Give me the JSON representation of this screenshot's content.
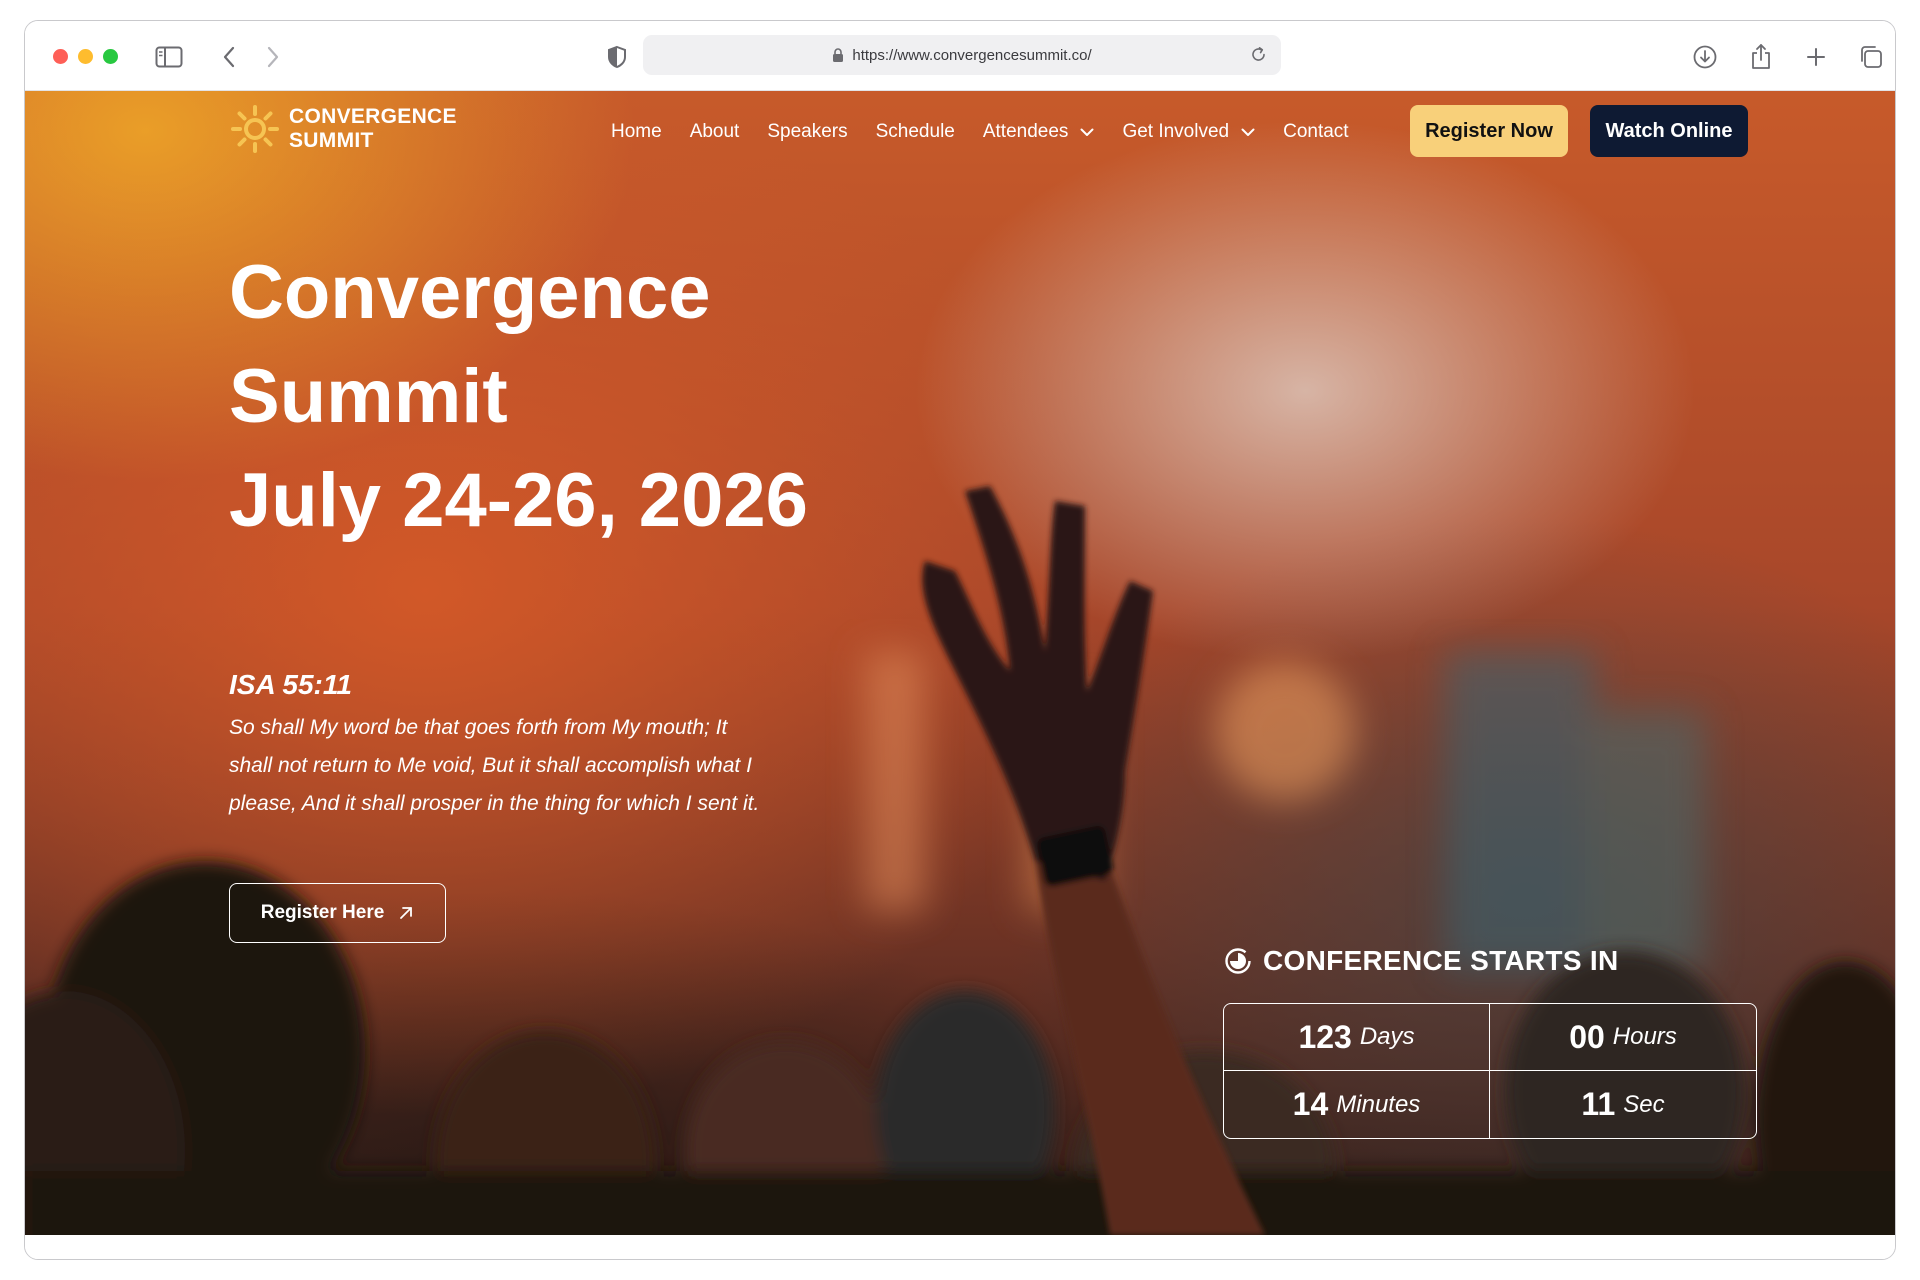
{
  "browser": {
    "url": "https://www.convergencesummit.co/"
  },
  "icons": {
    "sidebar": "sidebar-icon",
    "back": "chevron-left-icon",
    "forward": "chevron-right-icon",
    "shield": "shield-icon",
    "lock": "lock-icon",
    "reload": "reload-icon",
    "download": "download-icon",
    "share": "share-icon",
    "new_tab": "plus-icon",
    "tabs": "tabs-overview-icon"
  },
  "site": {
    "logo_line1": "CONVERGENCE",
    "logo_line2": "SUMMIT"
  },
  "nav": {
    "items": [
      "Home",
      "About",
      "Speakers",
      "Schedule",
      "Attendees",
      "Get Involved",
      "Contact"
    ],
    "register_now": "Register Now",
    "watch_online": "Watch Online"
  },
  "hero": {
    "title_line1": "Convergence",
    "title_line2": "Summit",
    "title_line3": "July 24-26, 2026",
    "verse_ref": "ISA 55:11",
    "verse_text": "So shall My word be that goes forth from My mouth; It shall not return to Me void, But it shall accomplish what I please, And it shall prosper in the thing for which I sent it.",
    "cta": "Register Here"
  },
  "countdown": {
    "title": "CONFERENCE STARTS IN",
    "days_value": "123",
    "days_label": "Days",
    "hours_value": "00",
    "hours_label": "Hours",
    "minutes_value": "14",
    "minutes_label": "Minutes",
    "seconds_value": "11",
    "seconds_label": "Sec"
  },
  "colors": {
    "accent_button": "#f8d07a",
    "dark_button": "#0e1a33",
    "logo_mark": "#f6c453"
  }
}
